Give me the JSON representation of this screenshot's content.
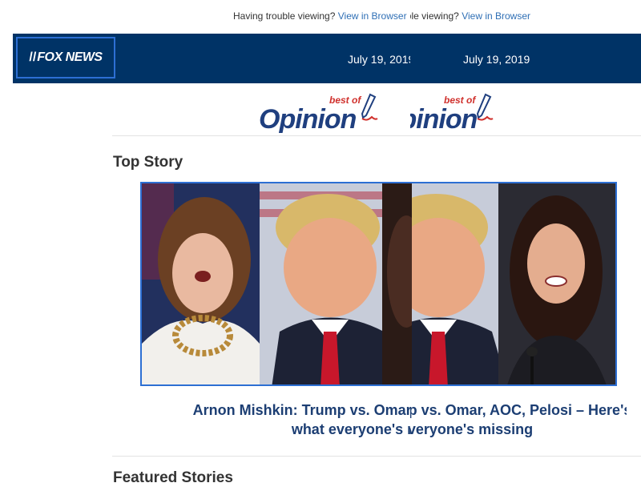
{
  "preheader": {
    "text": "Having trouble viewing?",
    "link": "View in Browser"
  },
  "header": {
    "logo": "FOX NEWS",
    "date": "July 19, 2019"
  },
  "banner": {
    "main": "Opinion",
    "tag": "best of",
    "icon": "pen-icon"
  },
  "top_story": {
    "section_title": "Top Story",
    "headline_line1": "Arnon Mishkin: Trump vs. Omar, AOC, Pelosi – Here's",
    "headline_line2": "what everyone's missing"
  },
  "featured": {
    "section_title": "Featured Stories"
  },
  "colors": {
    "brand_navy": "#003366",
    "link_blue": "#2f6fb5",
    "headline_navy": "#1c3e73",
    "accent_red": "#d0312d"
  }
}
